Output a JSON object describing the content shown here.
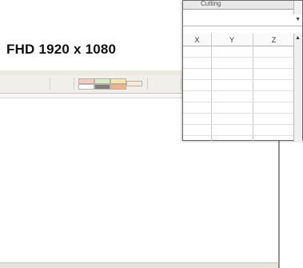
{
  "overlay_label": "FHD 1920 x 1080",
  "grid_window": {
    "header_title": "Cutting",
    "columns": [
      "X",
      "Y",
      "Z"
    ],
    "dropdown_icon": "chevron-down-icon",
    "scroll_up_icon": "triangle-up-icon"
  },
  "colors": {
    "ribbon": "#f1efe9",
    "window_border": "#6b6b6b"
  }
}
